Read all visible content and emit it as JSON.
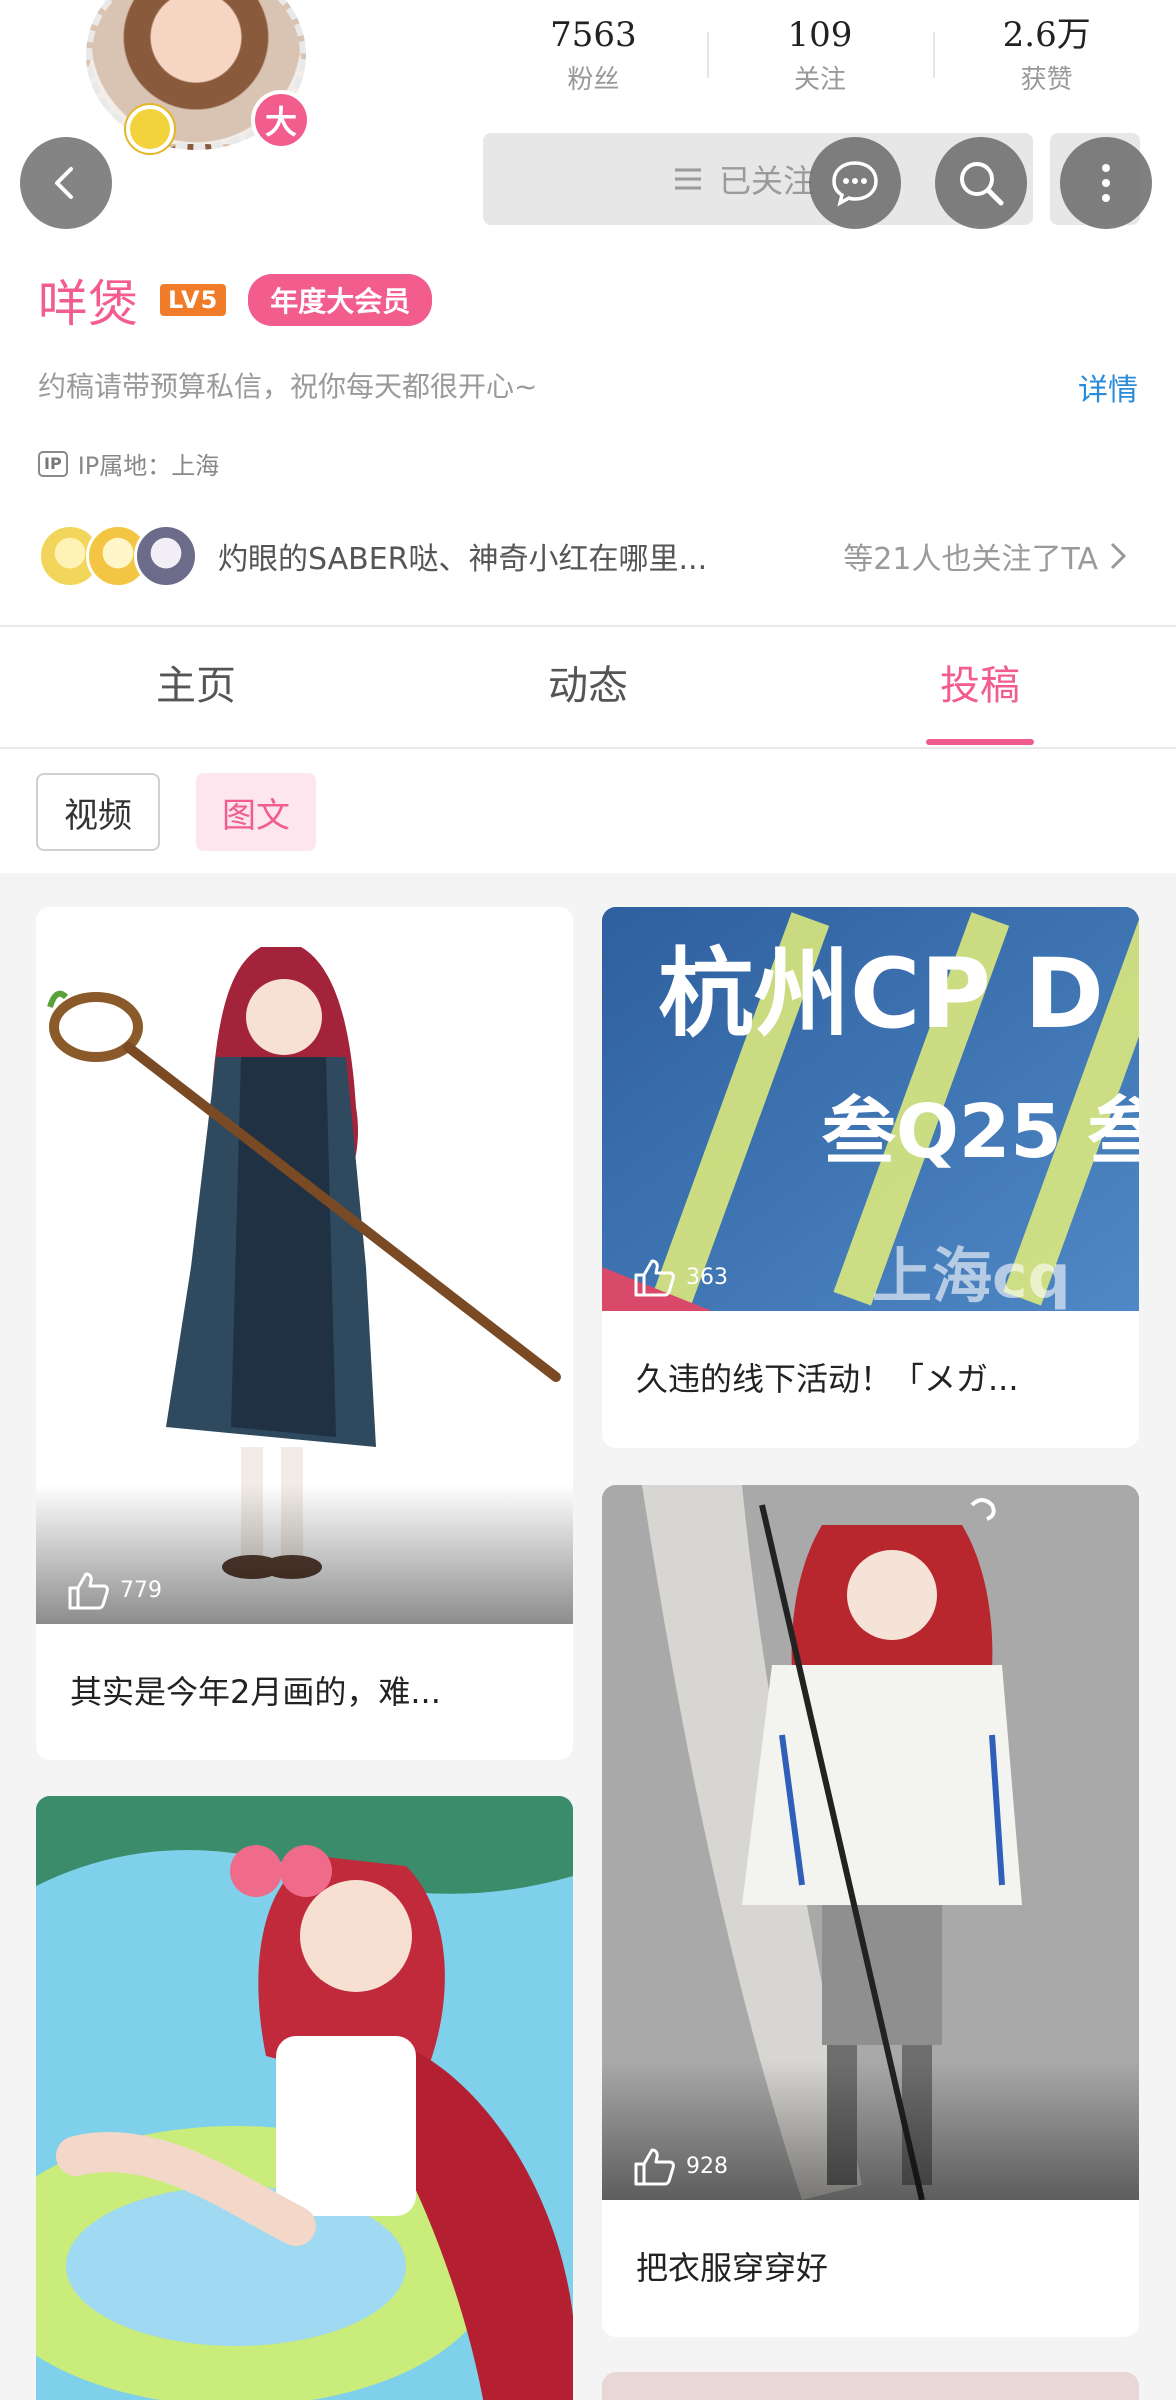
{
  "profile": {
    "username": "咩煲",
    "level": "LV5",
    "vip": "年度大会员",
    "big_badge": "大",
    "bio": "约稿请带预算私信，祝你每天都很开心~",
    "detail_link": "详情",
    "ip_label": "IP",
    "ip_location": "IP属地：上海"
  },
  "stats": [
    {
      "value": "7563",
      "label": "粉丝"
    },
    {
      "value": "109",
      "label": "关注"
    },
    {
      "value": "2.6万",
      "label": "获赞"
    }
  ],
  "actions": {
    "follow_label": "已关注"
  },
  "mutual": {
    "names": "灼眼的SABER哒、神奇小红在哪里...",
    "count_text": "等21人也关注了TA"
  },
  "tabs": [
    {
      "label": "主页",
      "active": false
    },
    {
      "label": "动态",
      "active": false
    },
    {
      "label": "投稿",
      "active": true
    }
  ],
  "subtabs": [
    {
      "label": "视频",
      "active": false
    },
    {
      "label": "图文",
      "active": true
    }
  ],
  "posts": [
    {
      "title": "其实是今年2月画的，难...",
      "likes": "779"
    },
    {
      "title": "久违的线下活动！「メガ...",
      "likes": "363",
      "image_text": {
        "line1": "杭州CP D",
        "line2": "叁Q25 叁",
        "line3": "上海cq"
      }
    },
    {
      "title": "",
      "likes": ""
    },
    {
      "title": "把衣服穿穿好",
      "likes": "928"
    }
  ],
  "colors": {
    "accent": "#f25d8e",
    "link": "#2b8bd8",
    "level": "#f07c2a",
    "muted": "#9a9a9a"
  },
  "icons": [
    "back-arrow-icon",
    "menu-lines-icon",
    "chat-bubble-icon",
    "search-icon",
    "more-vertical-icon",
    "chevron-right-icon",
    "thumbs-up-icon"
  ]
}
